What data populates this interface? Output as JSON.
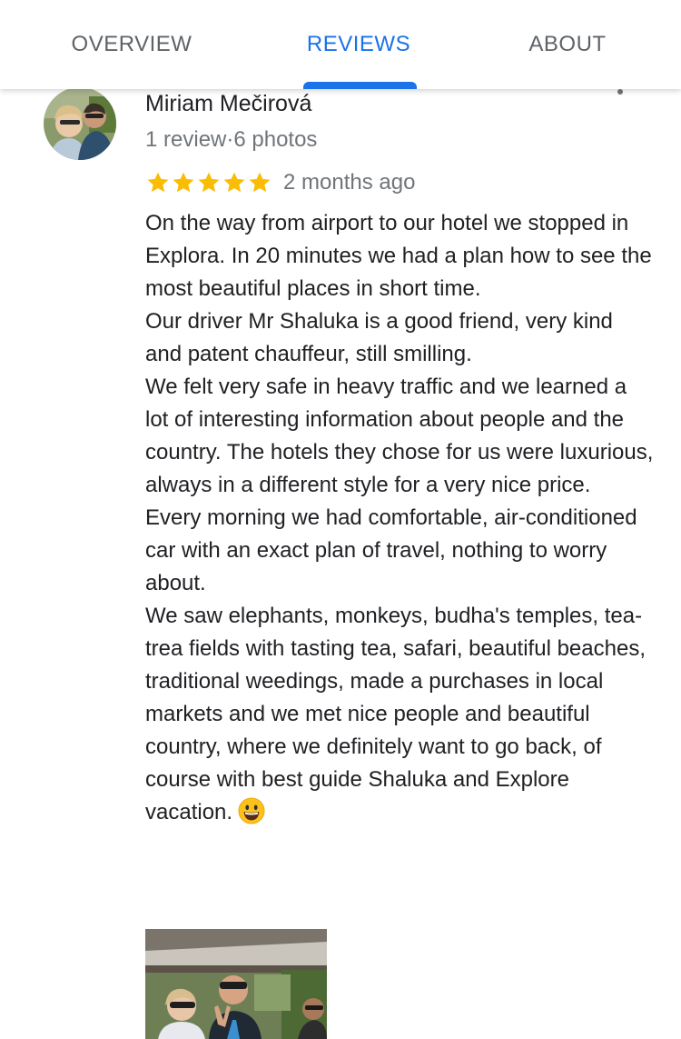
{
  "tabs": {
    "overview": "OVERVIEW",
    "reviews": "REVIEWS",
    "about": "ABOUT",
    "active": "reviews"
  },
  "review": {
    "author": "Miriam Mečirová",
    "meta": "1 review·6 photos",
    "rating": 5,
    "date": "2 months ago",
    "text": "On the way from airport to our hotel we stopped in Explora. In 20 minutes we had a plan how to see the most beautiful places in short time.\nOur driver Mr Shaluka is a good friend, very kind and patent chauffeur, still smilling.\nWe felt very safe in heavy traffic and we learned a lot of interesting information about people and the country.  The hotels they chose for us were luxurious, always in a different style for a very nice price.\nEvery morning we had comfortable, air-conditioned car with an exact plan of travel, nothing to worry about.\nWe saw elephants, monkeys, budha's temples, tea-trea fields with tasting tea, safari, beautiful beaches, traditional weedings, made a purchases in local markets and we met nice people and beautiful country, where we definitely want to go back, of course with best guide Shaluka and Explore vacation.",
    "emoji": "grinning-face-icon"
  },
  "colors": {
    "accent": "#1a73e8",
    "star": "#fbbc04",
    "secondary_text": "#70757a",
    "tab_text": "#5f6368"
  }
}
